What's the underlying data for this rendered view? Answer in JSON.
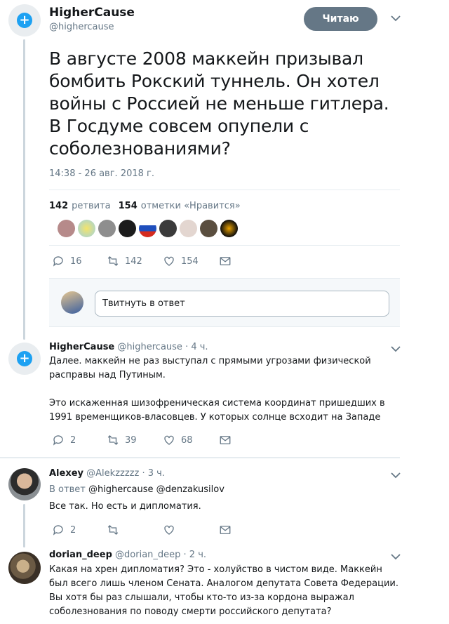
{
  "main_tweet": {
    "display_name": "HigherCause",
    "handle": "@highercause",
    "follow_label": "Читаю",
    "text": "В августе 2008 маккейн призывал бомбить Рокский туннель. Он хотел войны с Россией не меньше гитлера. В Госдуме совсем опупели с соболезнованиями?",
    "timestamp": "14:38 - 26 авг. 2018 г.",
    "retweets_count": "142",
    "retweets_label": "ретвита",
    "likes_count": "154",
    "likes_label": "отметки «Нравится»",
    "actions": {
      "replies": "16",
      "retweets": "142",
      "likes": "154"
    },
    "reply_placeholder": "Твитнуть в ответ"
  },
  "replies": [
    {
      "display_name": "HigherCause",
      "handle": "@highercause",
      "time": "· 4 ч.",
      "paragraph1": "Далее. маккейн не раз выступал с прямыми угрозами физической расправы над Путиным.",
      "paragraph2": "Это искаженная шизофреническая система координат пришедших в 1991 временщиков-власовцев. У которых солнце всходит на Западе",
      "actions": {
        "replies": "2",
        "retweets": "39",
        "likes": "68"
      }
    },
    {
      "display_name": "Alexey",
      "handle": "@Alekzzzzz",
      "time": "· 3 ч.",
      "reply_to_label": "В ответ",
      "reply_to_1": "@highercause",
      "reply_to_2": "@denzakusilov",
      "text": "Все так. Но есть и дипломатия.",
      "actions": {
        "replies": "2",
        "retweets": "",
        "likes": ""
      }
    },
    {
      "display_name": "dorian_deep",
      "handle": "@dorian_deep",
      "time": "· 2 ч.",
      "text": "Какая на хрен дипломатия? Это - холуйство в чистом виде. Маккейн был всего лишь членом Сената. Аналогом депутата Совета Федерации. Вы хотя бы раз слышали, чтобы кто-то из-за кордона выражал соболезнования по поводу смерти российского депутата?"
    }
  ],
  "colors": {
    "accent": "#1da1f2",
    "muted": "#657786",
    "follow_button": "#657786",
    "divider": "#e6ecf0"
  },
  "icons": [
    "plus-icon",
    "chevron-down-icon",
    "reply-icon",
    "retweet-icon",
    "like-icon",
    "message-icon"
  ]
}
